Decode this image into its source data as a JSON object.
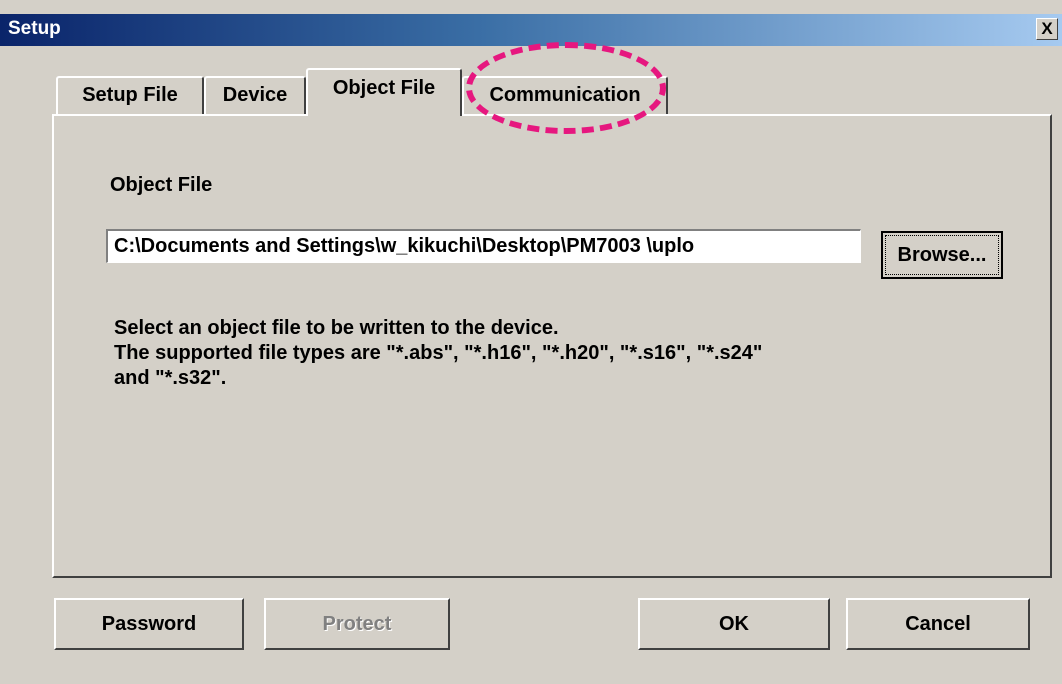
{
  "window": {
    "title": "Setup",
    "close_label": "X"
  },
  "tabs": [
    {
      "label": "Setup File"
    },
    {
      "label": "Device"
    },
    {
      "label": "Object File"
    },
    {
      "label": "Communication"
    }
  ],
  "active_tab": "Object File",
  "object_file": {
    "label": "Object File",
    "path_value": "C:\\Documents and Settings\\w_kikuchi\\Desktop\\PM7003 \\uplo",
    "browse_label": "Browse...",
    "description": [
      "Select an object file to be written to the device.",
      "The supported file types are \"*.abs\", \"*.h16\", \"*.h20\", \"*.s16\", \"*.s24\"",
      "and \"*.s32\"."
    ]
  },
  "footer": {
    "password_label": "Password",
    "protect_label": "Protect",
    "ok_label": "OK",
    "cancel_label": "Cancel"
  },
  "colors": {
    "title_bar_start": "#0a246a",
    "title_bar_end": "#a6caf0",
    "face": "#d4d0c8",
    "highlight_ring": "#e6177f"
  }
}
